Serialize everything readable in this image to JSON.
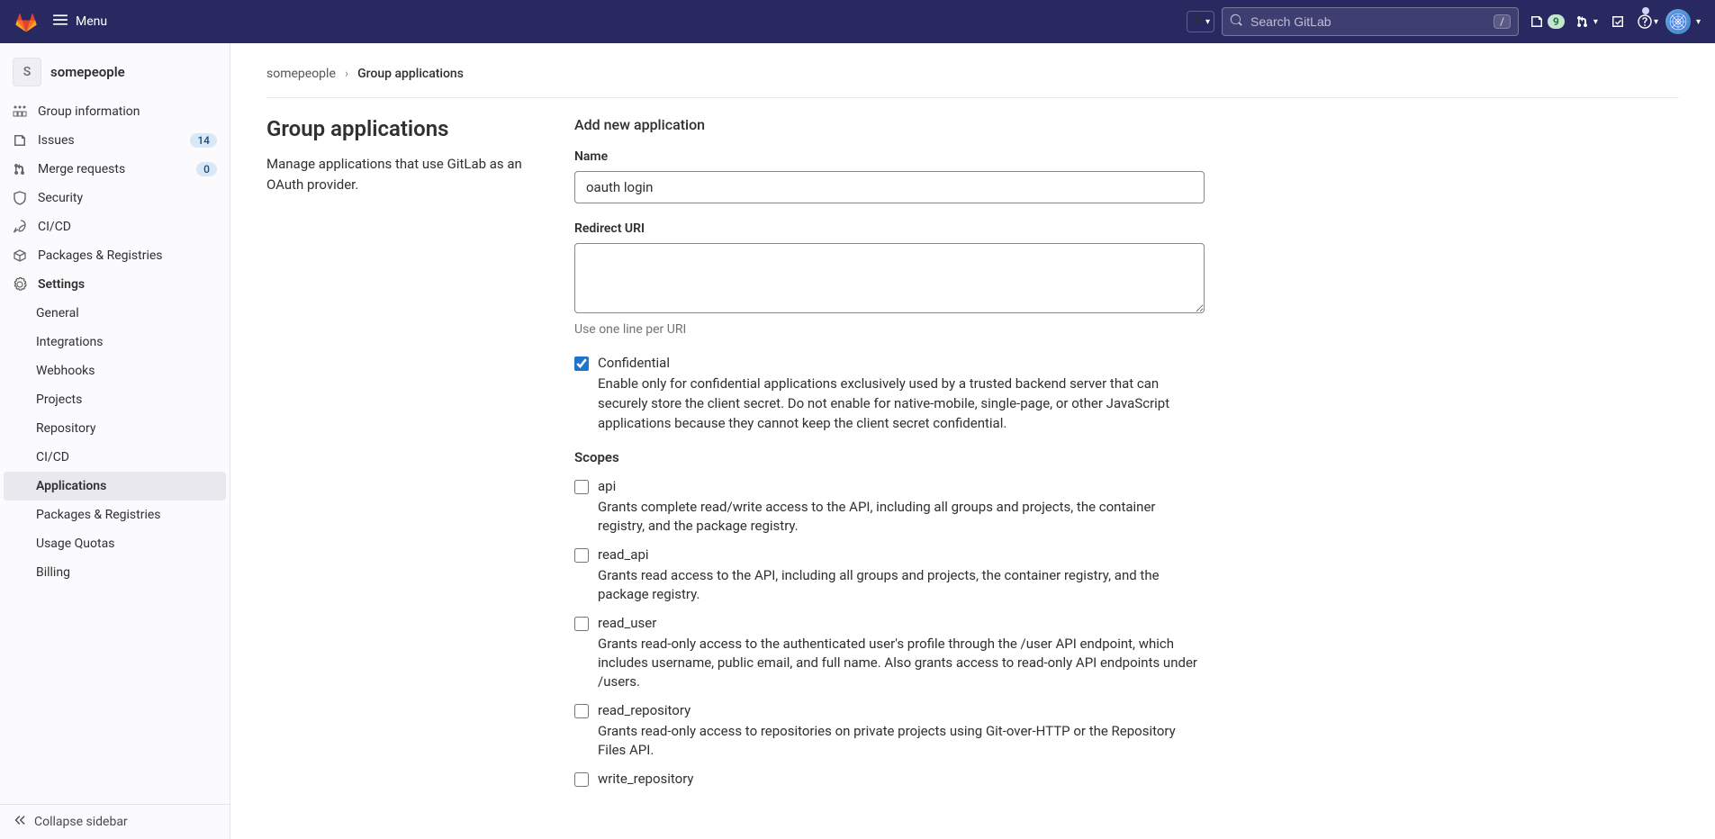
{
  "navbar": {
    "menu_label": "Menu",
    "search_placeholder": "Search GitLab",
    "slash_key": "/",
    "issues_count": "9"
  },
  "sidebar": {
    "group_initial": "S",
    "group_name": "somepeople",
    "items": [
      {
        "label": "Group information"
      },
      {
        "label": "Issues",
        "count": "14"
      },
      {
        "label": "Merge requests",
        "count": "0"
      },
      {
        "label": "Security"
      },
      {
        "label": "CI/CD"
      },
      {
        "label": "Packages & Registries"
      },
      {
        "label": "Settings"
      }
    ],
    "settings_sub": [
      {
        "label": "General"
      },
      {
        "label": "Integrations"
      },
      {
        "label": "Webhooks"
      },
      {
        "label": "Projects"
      },
      {
        "label": "Repository"
      },
      {
        "label": "CI/CD"
      },
      {
        "label": "Applications"
      },
      {
        "label": "Packages & Registries"
      },
      {
        "label": "Usage Quotas"
      },
      {
        "label": "Billing"
      }
    ],
    "collapse_label": "Collapse sidebar"
  },
  "breadcrumb": {
    "root": "somepeople",
    "current": "Group applications"
  },
  "main": {
    "title": "Group applications",
    "description": "Manage applications that use GitLab as an OAuth provider.",
    "form_title": "Add new application",
    "name_label": "Name",
    "name_value": "oauth login",
    "redirect_label": "Redirect URI",
    "redirect_value": "",
    "redirect_help": "Use one line per URI",
    "confidential_label": "Confidential",
    "confidential_checked": true,
    "confidential_desc": "Enable only for confidential applications exclusively used by a trusted backend server that can securely store the client secret. Do not enable for native-mobile, single-page, or other JavaScript applications because they cannot keep the client secret confidential.",
    "scopes_title": "Scopes",
    "scopes": [
      {
        "name": "api",
        "desc": "Grants complete read/write access to the API, including all groups and projects, the container registry, and the package registry."
      },
      {
        "name": "read_api",
        "desc": "Grants read access to the API, including all groups and projects, the container registry, and the package registry."
      },
      {
        "name": "read_user",
        "desc": "Grants read-only access to the authenticated user's profile through the /user API endpoint, which includes username, public email, and full name. Also grants access to read-only API endpoints under /users."
      },
      {
        "name": "read_repository",
        "desc": "Grants read-only access to repositories on private projects using Git-over-HTTP or the Repository Files API."
      },
      {
        "name": "write_repository",
        "desc": ""
      }
    ]
  }
}
